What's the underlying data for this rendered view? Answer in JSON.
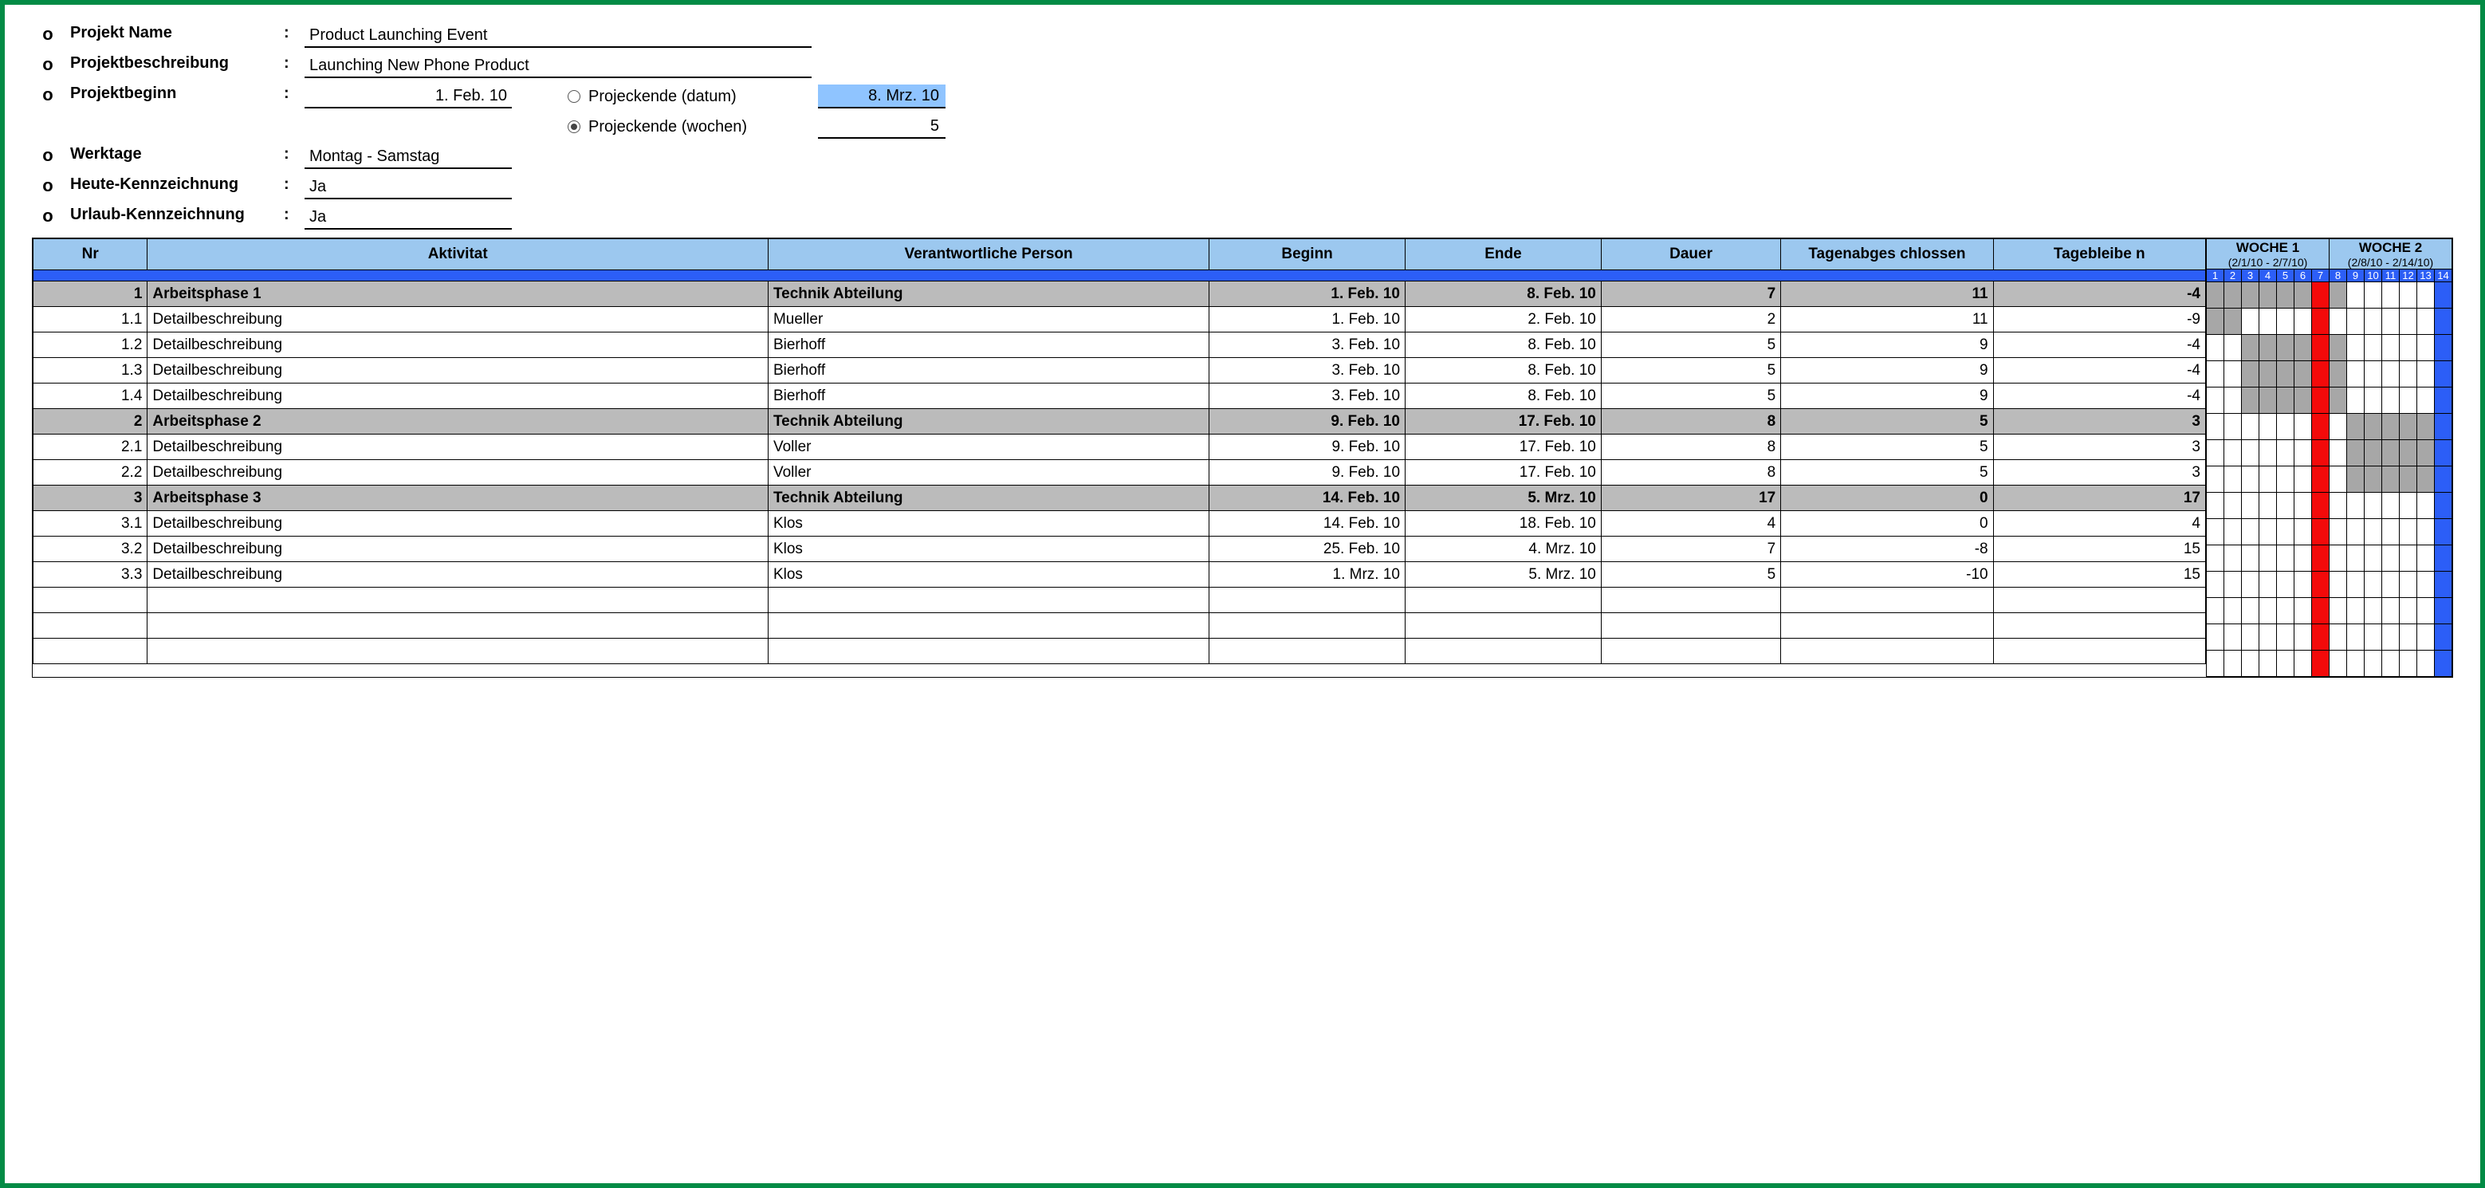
{
  "header": {
    "items": [
      {
        "label": "Projekt Name",
        "value": "Product Launching Event"
      },
      {
        "label": "Projektbeschreibung",
        "value": "Launching New Phone Product"
      },
      {
        "label": "Projektbeginn",
        "value": "1. Feb. 10",
        "right": true
      },
      {
        "label": "Werktage",
        "value": "Montag - Samstag"
      },
      {
        "label": "Heute-Kennzeichnung",
        "value": "Ja"
      },
      {
        "label": "Urlaub-Kennzeichnung",
        "value": "Ja"
      }
    ],
    "options": {
      "opt1": "Projeckende (datum)",
      "opt2": "Projeckende (wochen)",
      "val1": "8. Mrz. 10",
      "val2": "5"
    }
  },
  "columns": {
    "nr": "Nr",
    "akt": "Aktivitat",
    "per": "Verantwortliche Person",
    "beg": "Beginn",
    "end": "Ende",
    "dau": "Dauer",
    "tag1": "Tagenabges chlossen",
    "tag2": "Tagebleibe n"
  },
  "weeks": [
    {
      "title": "WOCHE 1",
      "range": "(2/1/10 - 2/7/10)",
      "days": [
        1,
        2,
        3,
        4,
        5,
        6,
        7
      ]
    },
    {
      "title": "WOCHE 2",
      "range": "(2/8/10 - 2/14/10)",
      "days": [
        8,
        9,
        10,
        11,
        12,
        13,
        14
      ]
    }
  ],
  "rows": [
    {
      "type": "phase",
      "nr": "1",
      "akt": "Arbeitsphase 1",
      "per": "Technik Abteilung",
      "beg": "1. Feb. 10",
      "end": "8. Feb. 10",
      "dau": 7,
      "t1": 11,
      "t2": -4,
      "bar": [
        1,
        8
      ]
    },
    {
      "type": "task",
      "nr": "1.1",
      "akt": "Detailbeschreibung",
      "per": "Mueller",
      "beg": "1. Feb. 10",
      "end": "2. Feb. 10",
      "dau": 2,
      "t1": 11,
      "t2": -9,
      "bar": [
        1,
        2
      ]
    },
    {
      "type": "task",
      "nr": "1.2",
      "akt": "Detailbeschreibung",
      "per": "Bierhoff",
      "beg": "3. Feb. 10",
      "end": "8. Feb. 10",
      "dau": 5,
      "t1": 9,
      "t2": -4,
      "bar": [
        3,
        8
      ]
    },
    {
      "type": "task",
      "nr": "1.3",
      "akt": "Detailbeschreibung",
      "per": "Bierhoff",
      "beg": "3. Feb. 10",
      "end": "8. Feb. 10",
      "dau": 5,
      "t1": 9,
      "t2": -4,
      "bar": [
        3,
        8
      ]
    },
    {
      "type": "task",
      "nr": "1.4",
      "akt": "Detailbeschreibung",
      "per": "Bierhoff",
      "beg": "3. Feb. 10",
      "end": "8. Feb. 10",
      "dau": 5,
      "t1": 9,
      "t2": -4,
      "bar": [
        3,
        8
      ]
    },
    {
      "type": "phase",
      "nr": "2",
      "akt": "Arbeitsphase 2",
      "per": "Technik Abteilung",
      "beg": "9. Feb. 10",
      "end": "17. Feb. 10",
      "dau": 8,
      "t1": 5,
      "t2": 3,
      "bar": [
        9,
        14
      ]
    },
    {
      "type": "task",
      "nr": "2.1",
      "akt": "Detailbeschreibung",
      "per": "Voller",
      "beg": "9. Feb. 10",
      "end": "17. Feb. 10",
      "dau": 8,
      "t1": 5,
      "t2": 3,
      "bar": [
        9,
        14
      ]
    },
    {
      "type": "task",
      "nr": "2.2",
      "akt": "Detailbeschreibung",
      "per": "Voller",
      "beg": "9. Feb. 10",
      "end": "17. Feb. 10",
      "dau": 8,
      "t1": 5,
      "t2": 3,
      "bar": [
        9,
        14
      ]
    },
    {
      "type": "phase",
      "nr": "3",
      "akt": "Arbeitsphase 3",
      "per": "Technik Abteilung",
      "beg": "14. Feb. 10",
      "end": "5. Mrz. 10",
      "dau": 17,
      "t1": 0,
      "t2": 17,
      "bar": [
        14,
        14
      ]
    },
    {
      "type": "task",
      "nr": "3.1",
      "akt": "Detailbeschreibung",
      "per": "Klos",
      "beg": "14. Feb. 10",
      "end": "18. Feb. 10",
      "dau": 4,
      "t1": 0,
      "t2": 4,
      "bar": null
    },
    {
      "type": "task",
      "nr": "3.2",
      "akt": "Detailbeschreibung",
      "per": "Klos",
      "beg": "25. Feb. 10",
      "end": "4. Mrz. 10",
      "dau": 7,
      "t1": -8,
      "t2": 15,
      "bar": null
    },
    {
      "type": "task",
      "nr": "3.3",
      "akt": "Detailbeschreibung",
      "per": "Klos",
      "beg": "1. Mrz. 10",
      "end": "5. Mrz. 10",
      "dau": 5,
      "t1": -10,
      "t2": 15,
      "bar": null
    },
    {
      "type": "empty"
    },
    {
      "type": "empty"
    },
    {
      "type": "empty"
    }
  ],
  "gantt": {
    "todayCol": 7,
    "endCol": 14,
    "totalDays": 14
  }
}
